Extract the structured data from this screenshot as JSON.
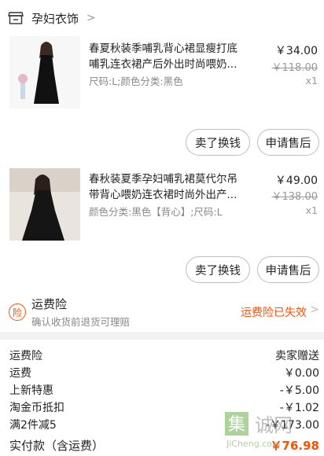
{
  "shop": {
    "name": "孕妇衣饰",
    "icon": "store-icon"
  },
  "items": [
    {
      "title": "春夏秋装季哺乳背心裙显瘦打底哺乳连衣裙产后外出时尚喂奶...",
      "sku": "尺码:L;颜色分类:黑色",
      "price": "￥34.00",
      "original_price": "￥118.00",
      "quantity": "x1",
      "buttons": [
        "卖了换钱",
        "申请售后"
      ]
    },
    {
      "title": "春秋装夏季孕妇哺乳裙莫代尔吊带背心喂奶连衣裙时尚外出产...",
      "sku": "颜色分类:黑色【背心】;尺码:L",
      "price": "￥49.00",
      "original_price": "￥138.00",
      "quantity": "x1",
      "buttons": [
        "卖了换钱",
        "申请售后"
      ]
    }
  ],
  "insurance": {
    "icon_text": "险",
    "title": "运费险",
    "desc": "确认收货前退货可理赔",
    "status": "运费险已失效"
  },
  "summary": {
    "rows": [
      {
        "label": "运费险",
        "value": "卖家赠送"
      },
      {
        "label": "运费",
        "value": "￥0.00"
      },
      {
        "label": "上新特惠",
        "value": "-￥5.00"
      },
      {
        "label": "淘金币抵扣",
        "value": "-￥1.02"
      },
      {
        "label": "满2件减5",
        "value": "-￥173.00"
      }
    ],
    "total_label": "实付款（含运费）",
    "total_value": "￥76.98"
  },
  "watermark": {
    "glyph": "集",
    "text": "诚网",
    "url": "JiCheng.com"
  },
  "colors": {
    "accent": "#ff5000",
    "muted": "#888888",
    "background": "#f2f2f2"
  }
}
